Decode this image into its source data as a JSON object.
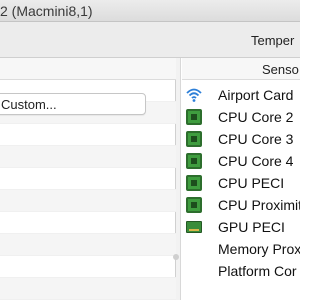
{
  "window": {
    "title": "2 (Macmini8,1)"
  },
  "header": {
    "column_label": "Temper"
  },
  "left": {
    "custom_select": "Custom..."
  },
  "right": {
    "header": "Senso",
    "sensors": [
      {
        "label": "Airport Card",
        "icon": "wifi-icon"
      },
      {
        "label": "CPU Core 2",
        "icon": "cpu-chip-icon"
      },
      {
        "label": "CPU Core 3",
        "icon": "cpu-chip-icon"
      },
      {
        "label": "CPU Core 4",
        "icon": "cpu-chip-icon"
      },
      {
        "label": "CPU PECI",
        "icon": "cpu-chip-icon"
      },
      {
        "label": "CPU Proximit",
        "icon": "cpu-chip-icon"
      },
      {
        "label": "GPU PECI",
        "icon": "gpu-card-icon"
      },
      {
        "label": "Memory Prox",
        "icon": ""
      },
      {
        "label": "Platform Cor",
        "icon": ""
      }
    ]
  },
  "colors": {
    "chip": "#3f9d3f",
    "wifi": "#2d7fd8"
  }
}
